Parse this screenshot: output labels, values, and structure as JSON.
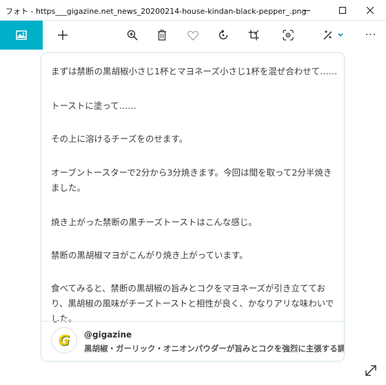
{
  "window": {
    "title": "フォト - https___gigazine.net_news_20200214-house-kindan-black-pepper_.png"
  },
  "toolbar": {
    "photo_icon": "photo-icon",
    "add_icon": "add-icon",
    "zoom_icon": "zoom-in-icon",
    "delete_icon": "delete-icon",
    "favorite_icon": "heart-icon",
    "rotate_icon": "rotate-icon",
    "crop_icon": "crop-icon",
    "enhance_icon": "enhance-icon",
    "edit_icon": "edit-icon",
    "more_label": "···",
    "accent": "#00b0c8"
  },
  "card": {
    "paragraphs": [
      "まずは禁断の黒胡椒小さじ1杯とマヨネーズ小さじ1杯を混ぜ合わせて……",
      "トーストに塗って……",
      "その上に溶けるチーズをのせます。",
      "オーブントースターで2分から3分焼きます。今回は間を取って2分半焼きました。",
      "焼き上がった禁断の黒チーズトーストはこんな感じ。",
      "禁断の黒胡椒マヨがこんがり焼き上がっています。",
      "食べてみると、禁断の黒胡椒の旨みとコクをマヨネーズが引き立てており、黒胡椒の風味がチーズトーストと相性が良く、かなりアリな味わいでした。"
    ],
    "embed": {
      "logo_letter": "G",
      "handle": "@gigazine",
      "title": "黒胡椒・ガーリック・オニオンパウダーが旨みとコクを強烈に主張する調味料「禁断"
    }
  }
}
